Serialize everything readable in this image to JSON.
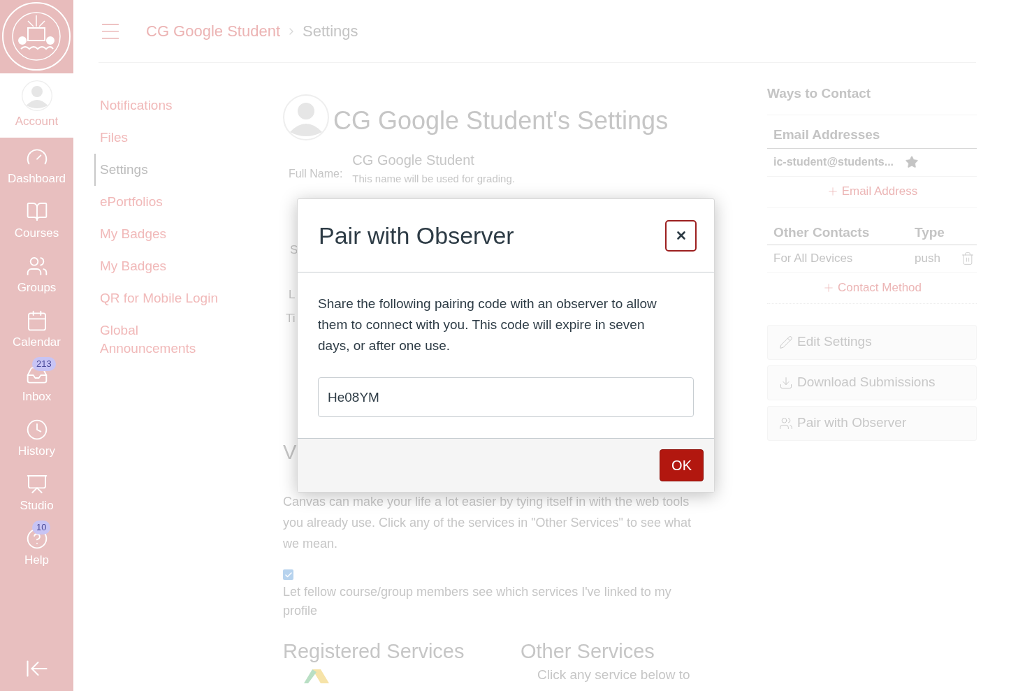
{
  "global_nav": {
    "items": [
      {
        "label": "Account",
        "kind": "account",
        "selected": true
      },
      {
        "label": "Dashboard",
        "kind": "dashboard",
        "selected": false
      },
      {
        "label": "Courses",
        "kind": "courses",
        "selected": false
      },
      {
        "label": "Groups",
        "kind": "groups",
        "selected": false
      },
      {
        "label": "Calendar",
        "kind": "calendar",
        "selected": false
      },
      {
        "label": "Inbox",
        "kind": "inbox",
        "selected": false,
        "badge": "213"
      },
      {
        "label": "History",
        "kind": "history",
        "selected": false
      },
      {
        "label": "Studio",
        "kind": "studio",
        "selected": false
      },
      {
        "label": "Help",
        "kind": "help",
        "selected": false,
        "badge": "10"
      }
    ]
  },
  "header": {
    "breadcrumbs": [
      "CG Google Student",
      "Settings"
    ]
  },
  "course_nav": {
    "items": [
      {
        "label": "Notifications",
        "selected": false
      },
      {
        "label": "Files",
        "selected": false
      },
      {
        "label": "Settings",
        "selected": true
      },
      {
        "label": "ePortfolios",
        "selected": false
      },
      {
        "label": "My Badges",
        "selected": false
      },
      {
        "label": "My Badges",
        "selected": false
      },
      {
        "label": "QR for Mobile Login",
        "selected": false
      },
      {
        "label": "Global Announcements",
        "selected": false
      }
    ]
  },
  "main": {
    "title": "CG Google Student's Settings",
    "full_name_label": "Full Name:",
    "full_name": "CG Google Student",
    "full_name_hint": "This name will be used for grading.",
    "hidden_fragments": [
      "S",
      "L",
      "Ti"
    ],
    "services_heading_fragment": "V",
    "services_intro": "Canvas can make your life a lot easier by tying itself in with the web tools you already use. Click any of the services in \"Other Services\" to see what we mean.",
    "share_services": {
      "checked": true,
      "label": "Let fellow course/group members see which services I've linked to my profile"
    },
    "registered_services": "Registered Services",
    "other_services": "Other Services",
    "other_services_hint": "Click any service below to"
  },
  "contact": {
    "title": "Ways to Contact",
    "email_heading": "Email Addresses",
    "emails": [
      {
        "address": "ic-student@students...",
        "default": true
      }
    ],
    "add_email": "Email Address",
    "other_heading": "Other Contacts",
    "type_heading": "Type",
    "others": [
      {
        "name": "For All Devices",
        "type": "push"
      }
    ],
    "add_contact": "Contact Method"
  },
  "actions": [
    {
      "label": "Edit Settings",
      "kind": "edit"
    },
    {
      "label": "Download Submissions",
      "kind": "download"
    },
    {
      "label": "Pair with Observer",
      "kind": "pair"
    }
  ],
  "dialog": {
    "title": "Pair with Observer",
    "message": "Share the following pairing code with an observer to allow them to connect with you. This code will expire in seven days, or after one use.",
    "code": "He08YM",
    "ok": "OK"
  }
}
